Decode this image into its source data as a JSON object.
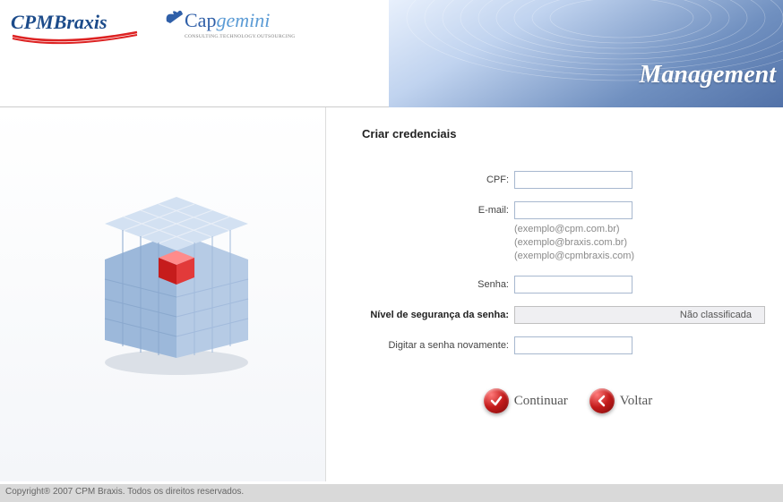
{
  "logo": {
    "brand1_text1": "CPM",
    "brand1_text2": "Braxis",
    "brand2_text1": "Cap",
    "brand2_text2": "gemini",
    "brand2_tagline": "CONSULTING.TECHNOLOGY.OUTSOURCING"
  },
  "header": {
    "title": "Management"
  },
  "page_title": "Criar credenciais",
  "form": {
    "cpf_label": "CPF:",
    "email_label": "E-mail:",
    "email_hint1": "(exemplo@cpm.com.br)",
    "email_hint2": "(exemplo@braxis.com.br)",
    "email_hint3": "(exemplo@cpmbraxis.com)",
    "senha_label": "Senha:",
    "strength_label": "Nível de segurança da senha:",
    "strength_value": "Não classificada",
    "repeat_label": "Digitar a senha novamente:"
  },
  "buttons": {
    "continuar": "Continuar",
    "voltar": "Voltar"
  },
  "footer": "Copyright® 2007 CPM Braxis. Todos os direitos reservados."
}
